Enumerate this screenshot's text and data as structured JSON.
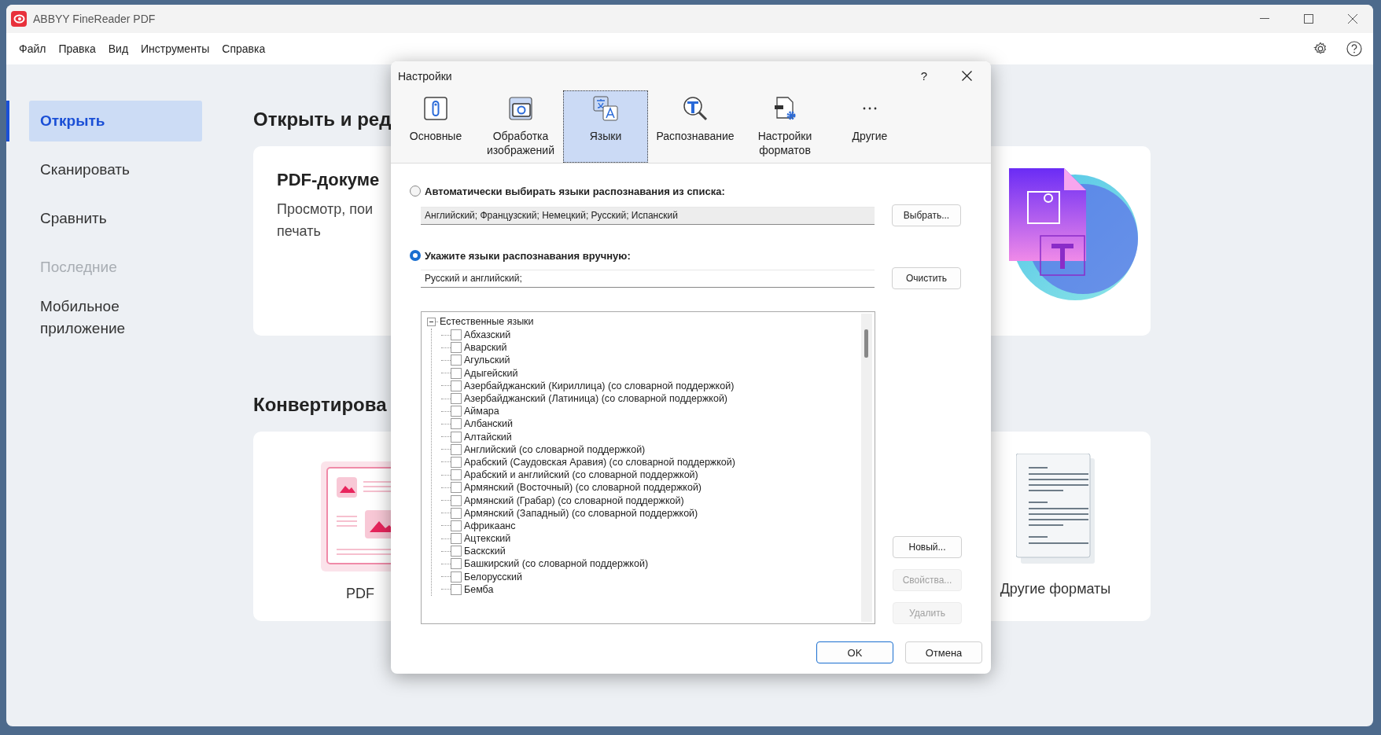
{
  "window": {
    "title": "ABBYY FineReader PDF"
  },
  "menu": [
    "Файл",
    "Правка",
    "Вид",
    "Инструменты",
    "Справка"
  ],
  "sidebar": {
    "items": [
      {
        "label": "Открыть",
        "selected": true,
        "disabled": false
      },
      {
        "label": "Сканировать",
        "selected": false,
        "disabled": false
      },
      {
        "label": "Сравнить",
        "selected": false,
        "disabled": false
      },
      {
        "label": "Последние",
        "selected": false,
        "disabled": true
      },
      {
        "label": "Мобильное приложение",
        "selected": false,
        "disabled": false
      }
    ]
  },
  "open_section": {
    "heading": "Открыть и ред",
    "card": {
      "title": "PDF-докуме",
      "description": [
        "Просмотр, пои",
        "печать"
      ]
    }
  },
  "convert_section": {
    "heading": "Конвертирова",
    "cards": [
      {
        "label": "PDF",
        "kind": "pdf"
      },
      {
        "label": "Другие форматы",
        "kind": "other"
      }
    ]
  },
  "dialog": {
    "title": "Настройки",
    "help_label": "?",
    "tabs": [
      {
        "label": "Основные",
        "kind": "general",
        "selected": false
      },
      {
        "label": "Обработка изображений",
        "kind": "image",
        "selected": false
      },
      {
        "label": "Языки",
        "kind": "languages",
        "selected": true
      },
      {
        "label": "Распознавание",
        "kind": "recognition",
        "selected": false
      },
      {
        "label": "Настройки форматов",
        "kind": "formats",
        "selected": false
      },
      {
        "label": "Другие",
        "kind": "more",
        "selected": false
      }
    ],
    "auto": {
      "label": "Автоматически выбирать языки распознавания из списка:",
      "selected": false,
      "value": "Английский; Французский; Немецкий; Русский; Испанский",
      "button": "Выбрать..."
    },
    "manual": {
      "label": "Укажите языки распознавания вручную:",
      "selected": true,
      "value": "Русский и английский;",
      "button": "Очистить"
    },
    "tree": {
      "label": "Естественные языки",
      "expanded": true,
      "children": [
        {
          "label": "Абхазский",
          "checked": false
        },
        {
          "label": "Аварский",
          "checked": false
        },
        {
          "label": "Агульский",
          "checked": false
        },
        {
          "label": "Адыгейский",
          "checked": false
        },
        {
          "label": "Азербайджанский (Кириллица) (со словарной поддержкой)",
          "checked": false
        },
        {
          "label": "Азербайджанский (Латиница) (со словарной поддержкой)",
          "checked": false
        },
        {
          "label": "Аймара",
          "checked": false
        },
        {
          "label": "Албанский",
          "checked": false
        },
        {
          "label": "Алтайский",
          "checked": false
        },
        {
          "label": "Английский (со словарной поддержкой)",
          "checked": false
        },
        {
          "label": "Арабский (Саудовская Аравия) (со словарной поддержкой)",
          "checked": false
        },
        {
          "label": "Арабский и английский (со словарной поддержкой)",
          "checked": false
        },
        {
          "label": "Армянский (Восточный) (со словарной поддержкой)",
          "checked": false
        },
        {
          "label": "Армянский (Грабар) (со словарной поддержкой)",
          "checked": false
        },
        {
          "label": "Армянский (Западный) (со словарной поддержкой)",
          "checked": false
        },
        {
          "label": "Африкаанс",
          "checked": false
        },
        {
          "label": "Ацтекский",
          "checked": false
        },
        {
          "label": "Баскский",
          "checked": false
        },
        {
          "label": "Башкирский (со словарной поддержкой)",
          "checked": false
        },
        {
          "label": "Белорусский",
          "checked": false
        },
        {
          "label": "Бемба",
          "checked": false
        }
      ]
    },
    "side_buttons": [
      {
        "label": "Новый...",
        "disabled": false
      },
      {
        "label": "Свойства...",
        "disabled": true
      },
      {
        "label": "Удалить",
        "disabled": true
      }
    ],
    "footer_buttons": [
      {
        "label": "OK",
        "primary": true
      },
      {
        "label": "Отмена",
        "primary": false
      }
    ]
  }
}
